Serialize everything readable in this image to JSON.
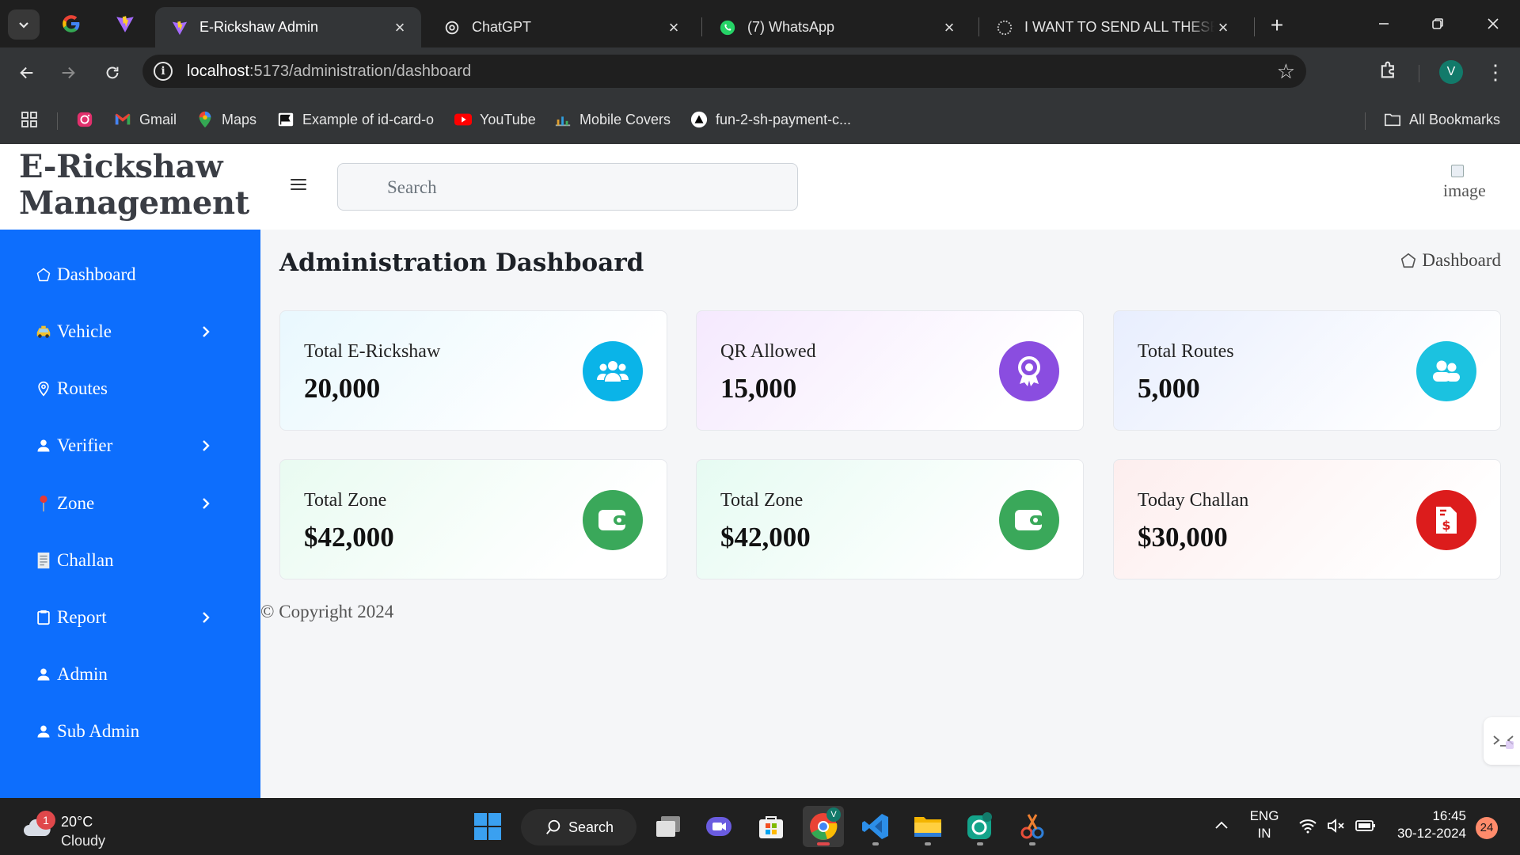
{
  "browser": {
    "tabs": [
      {
        "title": "E-Rickshaw Admin",
        "active": true
      },
      {
        "title": "ChatGPT",
        "active": false
      },
      {
        "title": "(7) WhatsApp",
        "active": false
      },
      {
        "title": "I WANT TO SEND ALL THESE F",
        "active": false
      }
    ],
    "url_host": "localhost",
    "url_path": ":5173/administration/dashboard",
    "profile_initial": "V",
    "bookmarks": [
      "Gmail",
      "Maps",
      "Example of id-card-o",
      "YouTube",
      "Mobile Covers",
      "fun-2-sh-payment-c..."
    ],
    "all_bookmarks": "All Bookmarks"
  },
  "app": {
    "brand_line1": "E-Rickshaw",
    "brand_line2": "Management",
    "search_placeholder": "Search",
    "broken_image_alt": "image",
    "sidebar": [
      {
        "label": "Dashboard",
        "icon": "dashboard-icon",
        "has_submenu": false
      },
      {
        "label": "Vehicle",
        "icon": "taxi-icon",
        "has_submenu": true
      },
      {
        "label": "Routes",
        "icon": "location-pin-icon",
        "has_submenu": false
      },
      {
        "label": "Verifier",
        "icon": "person-icon",
        "has_submenu": true
      },
      {
        "label": "Zone",
        "icon": "red-pushpin-icon",
        "has_submenu": true
      },
      {
        "label": "Challan",
        "icon": "receipt-icon",
        "has_submenu": false
      },
      {
        "label": "Report",
        "icon": "clipboard-icon",
        "has_submenu": true
      },
      {
        "label": "Admin",
        "icon": "person-icon",
        "has_submenu": false
      },
      {
        "label": "Sub Admin",
        "icon": "person-icon",
        "has_submenu": false
      }
    ],
    "page_title": "Administration Dashboard",
    "breadcrumb": "Dashboard",
    "cards": [
      {
        "label": "Total E-Rickshaw",
        "value": "20,000",
        "icon": "users-icon",
        "icon_color": "#0ab4e8"
      },
      {
        "label": "QR Allowed",
        "value": "15,000",
        "icon": "award-icon",
        "icon_color": "#8a4de0"
      },
      {
        "label": "Total Routes",
        "value": "5,000",
        "icon": "users-group-icon",
        "icon_color": "#1bc2e0"
      },
      {
        "label": "Total Zone",
        "value": "$42,000",
        "icon": "wallet-icon",
        "icon_color": "#3aa85a"
      },
      {
        "label": "Total Zone",
        "value": "$42,000",
        "icon": "wallet-icon",
        "icon_color": "#3aa85a"
      },
      {
        "label": "Today Challan",
        "value": "$30,000",
        "icon": "invoice-dollar-icon",
        "icon_color": "#dc1c1c"
      }
    ],
    "copyright": "© Copyright 2024",
    "colors": {
      "sidebar": "#0d6efd",
      "content_bg": "#f5f6f8"
    }
  },
  "taskbar": {
    "weather_temp": "20°C",
    "weather_desc": "Cloudy",
    "weather_badge": "1",
    "search_label": "Search",
    "lang_line1": "ENG",
    "lang_line2": "IN",
    "time": "16:45",
    "date": "30-12-2024",
    "notifications": "24"
  }
}
